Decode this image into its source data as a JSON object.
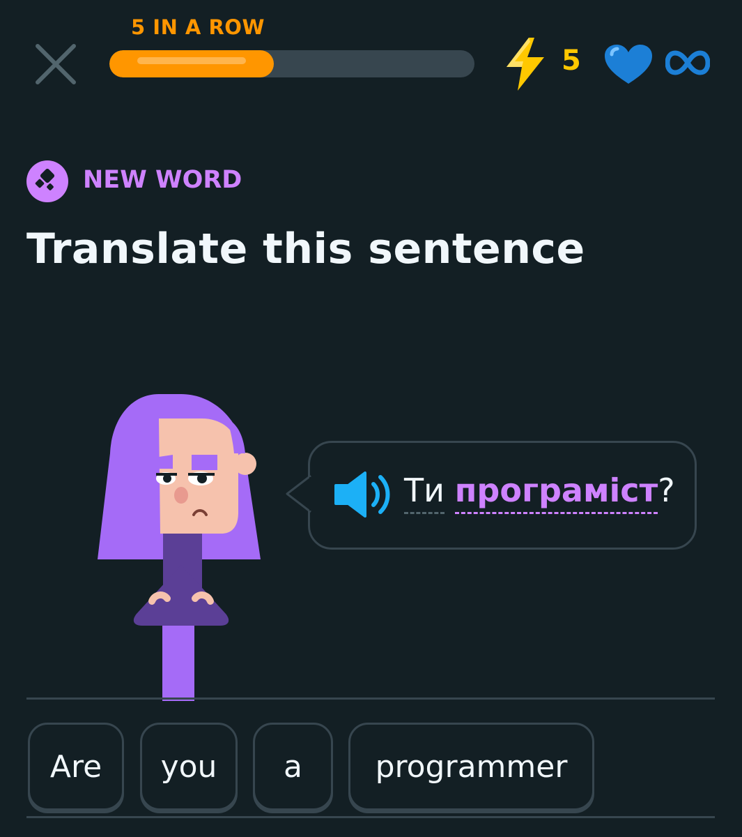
{
  "header": {
    "streak_label": "5 IN A ROW",
    "progress_fraction": 0.45,
    "energy_count": "5",
    "icons": {
      "close": "close-icon",
      "energy": "lightning-icon",
      "hearts": "heart-icon",
      "infinity": "infinity-icon"
    }
  },
  "challenge": {
    "badge_label": "NEW WORD",
    "badge_icon": "new-word-icon",
    "title": "Translate this sentence"
  },
  "prompt": {
    "speaker_icon": "speaker-icon",
    "words": [
      {
        "text": "Ти",
        "new": false
      },
      {
        "text": "програміст",
        "new": true
      }
    ],
    "punctuation": "?"
  },
  "answer_bank": {
    "tiles": [
      "Are",
      "you",
      "a",
      "programmer"
    ]
  },
  "colors": {
    "background": "#131f24",
    "accent_orange": "#ff9600",
    "energy_yellow": "#ffc800",
    "heart_blue": "#1cb0f6",
    "new_word_purple": "#ce82ff",
    "border": "#37464f"
  }
}
